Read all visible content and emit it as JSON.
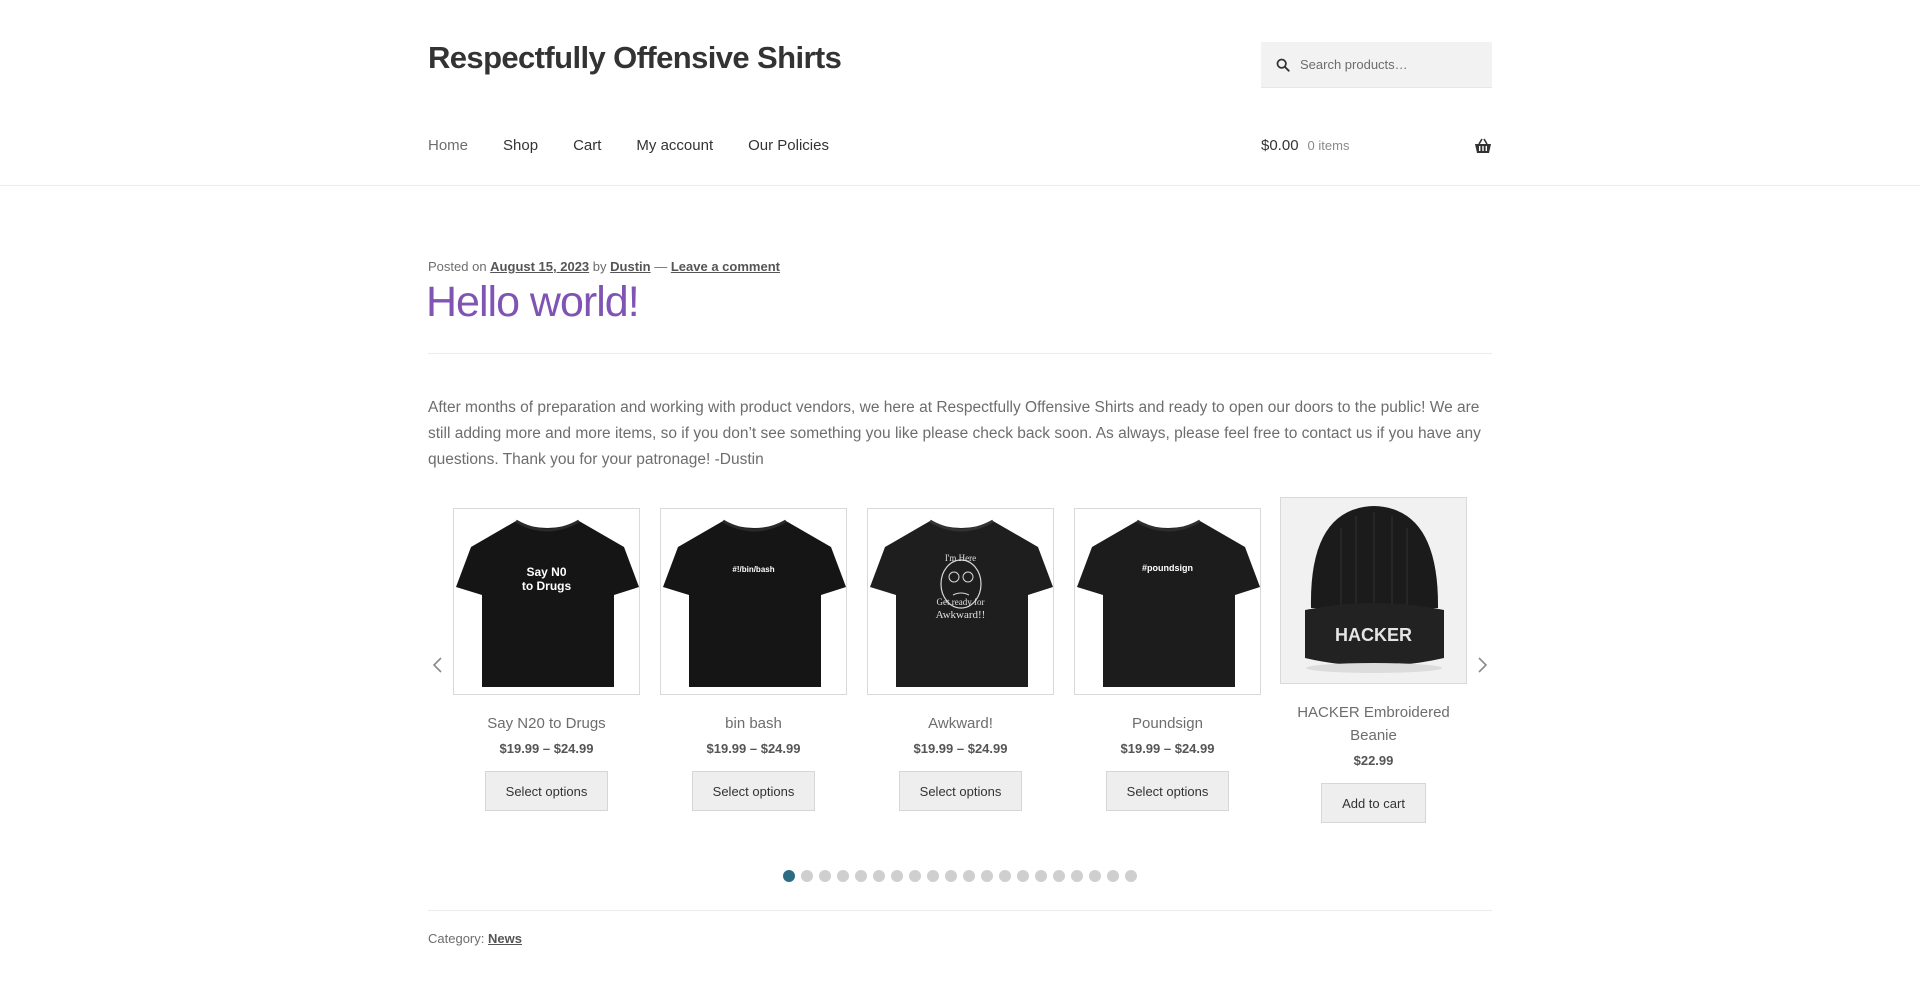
{
  "header": {
    "site_title": "Respectfully Offensive Shirts",
    "search": {
      "placeholder": "Search products…"
    }
  },
  "nav": {
    "items": [
      {
        "label": "Home"
      },
      {
        "label": "Shop"
      },
      {
        "label": "Cart"
      },
      {
        "label": "My account"
      },
      {
        "label": "Our Policies"
      }
    ]
  },
  "cart": {
    "amount": "$0.00",
    "count": "0 items"
  },
  "post": {
    "meta": {
      "posted_on": "Posted on",
      "date": "August 15, 2023",
      "by": "by",
      "author": "Dustin",
      "separator": "—",
      "comment_link": "Leave a comment"
    },
    "title": "Hello world!",
    "body": "After months of preparation and working with product vendors, we here at Respectfully Offensive Shirts and ready to open our doors to the public! We are still adding more and more items, so if you don’t see something you like please check back soon. As always, please feel free to contact us if you have any questions. Thank you for your patronage! -Dustin",
    "category_label": "Category:",
    "category": "News"
  },
  "products": [
    {
      "name": "Say N20 to Drugs",
      "price": "$19.99 – $24.99",
      "button": "Select options",
      "print_text": [
        "Say N0",
        "to Drugs"
      ]
    },
    {
      "name": "bin bash",
      "price": "$19.99 – $24.99",
      "button": "Select options",
      "print_text": [
        "#!/bin/bash"
      ]
    },
    {
      "name": "Awkward!",
      "price": "$19.99 – $24.99",
      "button": "Select options",
      "print_text": [
        "I'm Here",
        "Get ready for",
        "Awkward!!"
      ]
    },
    {
      "name": "Poundsign",
      "price": "$19.99 – $24.99",
      "button": "Select options",
      "print_text": [
        "#poundsign"
      ]
    },
    {
      "name": "HACKER Embroidered Beanie",
      "price": "$22.99",
      "button": "Add to cart",
      "print_text": [
        "HACKER"
      ]
    }
  ],
  "carousel": {
    "slide_count": 20,
    "active_index": 0
  },
  "colors": {
    "accent": "#7f54b3",
    "active_dot": "#2c6d83",
    "heading": "#333333",
    "body_text": "#6d6d6d"
  }
}
